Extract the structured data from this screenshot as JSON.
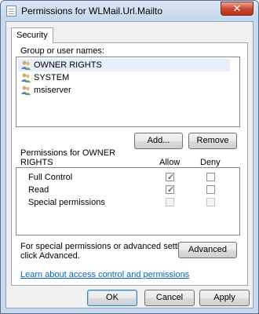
{
  "window": {
    "title": "Permissions for WLMail.Url.Mailto",
    "close_glyph": "✕"
  },
  "tabs": [
    {
      "label": "Security"
    }
  ],
  "groups": {
    "label": "Group or user names:",
    "items": [
      {
        "label": "OWNER RIGHTS",
        "selected": true
      },
      {
        "label": "SYSTEM",
        "selected": false
      },
      {
        "label": "msiserver",
        "selected": false
      }
    ],
    "add_label": "Add...",
    "remove_label": "Remove"
  },
  "permissions": {
    "heading_line1": "Permissions for OWNER",
    "heading_line2": "RIGHTS",
    "allow_label": "Allow",
    "deny_label": "Deny",
    "rows": [
      {
        "label": "Full Control",
        "allow": true,
        "deny": false,
        "allow_disabled": false,
        "deny_disabled": false
      },
      {
        "label": "Read",
        "allow": true,
        "deny": false,
        "allow_disabled": false,
        "deny_disabled": false
      },
      {
        "label": "Special permissions",
        "allow": false,
        "deny": false,
        "allow_disabled": true,
        "deny_disabled": true
      }
    ]
  },
  "advanced": {
    "text_line1": "For special permissions or advanced settings,",
    "text_line2": "click Advanced.",
    "button_label": "Advanced"
  },
  "link_text": "Learn about access control and permissions",
  "footer": {
    "ok_label": "OK",
    "cancel_label": "Cancel",
    "apply_label": "Apply"
  }
}
